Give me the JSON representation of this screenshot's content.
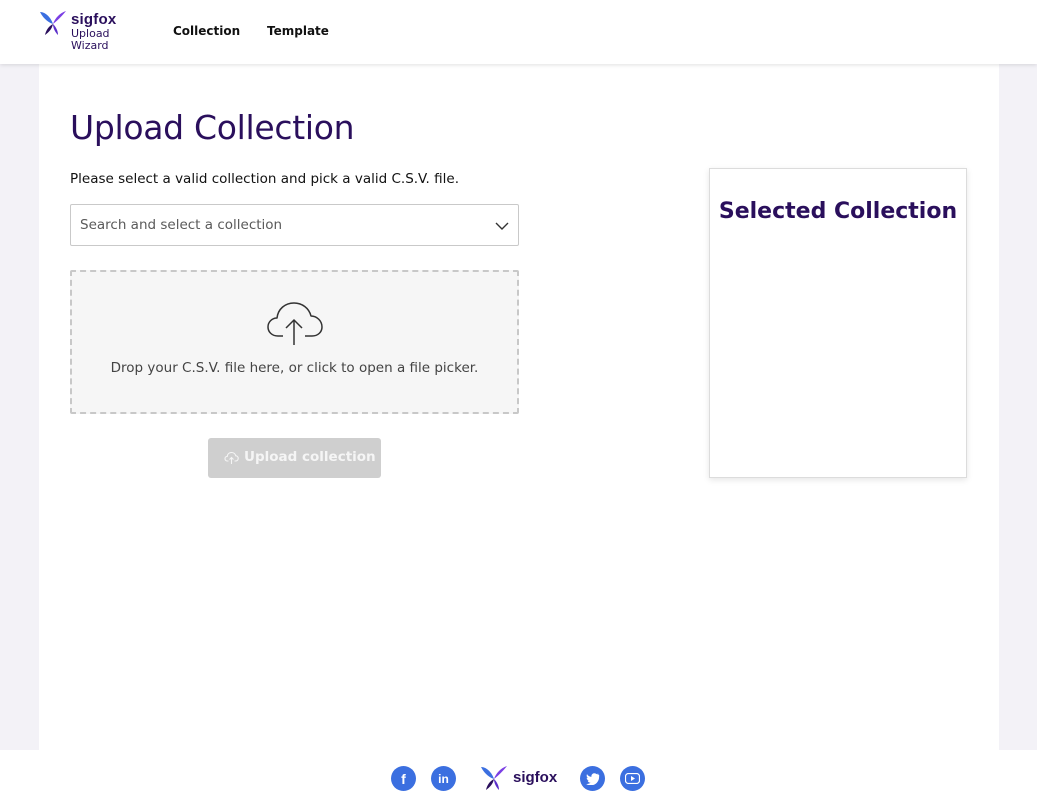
{
  "header": {
    "logo": {
      "brand": "sigfox",
      "sub_line1": "Upload",
      "sub_line2": "Wizard"
    },
    "nav": [
      {
        "label": "Collection"
      },
      {
        "label": "Template"
      }
    ]
  },
  "main": {
    "title": "Upload Collection",
    "instruction": "Please select a valid collection and pick a valid C.S.V. file.",
    "collection_select": {
      "placeholder": "Search and select a collection",
      "value": ""
    },
    "dropzone": {
      "text": "Drop your C.S.V. file here, or click to open a file picker.",
      "icon": "cloud-upload-icon"
    },
    "upload_button": {
      "label": "Upload collection",
      "state": "disabled"
    }
  },
  "side_panel": {
    "title": "Selected Collection"
  },
  "footer": {
    "brand": "sigfox",
    "social": [
      "facebook-icon",
      "linkedin-icon",
      "twitter-icon",
      "youtube-icon"
    ]
  },
  "colors": {
    "brand_purple": "#2a0f5c",
    "logo_blue": "#3b6fe0",
    "logo_purple": "#7b3fe4",
    "social_blue": "#3b6fe0",
    "disabled_button": "#cfcfcf",
    "page_background": "#f3f2f7"
  }
}
